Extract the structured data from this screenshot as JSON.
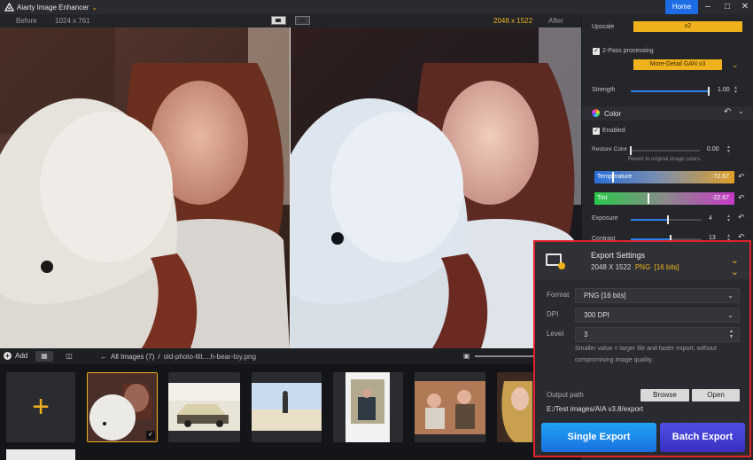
{
  "app": {
    "title": "Aiarty Image Enhancer",
    "home_label": "Home"
  },
  "compare": {
    "before_label": "Before",
    "input_size": "1024 x 761",
    "output_size": "2048 x 1522",
    "after_label": "After"
  },
  "strip": {
    "add_label": "Add",
    "breadcrumb_all": "All Images (7)",
    "breadcrumb_sep": "/",
    "breadcrumb_file": "old-photo-litt....h-bear-toy.png"
  },
  "panel": {
    "upscale_label": "Upscale",
    "upscale_value": "x2",
    "twopass_label": "2-Pass processing",
    "model_value": "More-Detail GAN  v3",
    "strength_label": "Strength",
    "strength_value": "1.00",
    "strength_level": 0.98,
    "color_header": "Color",
    "enabled_label": "Enabled",
    "restore_label": "Restore Color",
    "restore_value": "0.00",
    "restore_level": 0.0,
    "revert_text": "Revert to original image colors.",
    "temperature_label": "Temperature",
    "temperature_value": "-72.67",
    "tint_label": "Tint",
    "tint_value": "-22.67",
    "exposure_label": "Exposure",
    "exposure_value": "4",
    "exposure_level": 0.52,
    "contrast_label": "Contrast",
    "contrast_value": "13",
    "contrast_level": 0.56
  },
  "export": {
    "title": "Export Settings",
    "size": "2048 X 1522",
    "format_tag": "PNG",
    "bits_tag": "[16 bits]",
    "format_label": "Format",
    "format_value": "PNG   [16 bits]",
    "dpi_label": "DPI",
    "dpi_value": "300 DPI",
    "level_label": "Level",
    "level_value": "3",
    "note": "Smaller value = larger file and faster export, without compromising image quality.",
    "output_label": "Output path",
    "browse_label": "Browse",
    "open_label": "Open",
    "path_value": "E:/Test images/AIA v3.8/export",
    "single_label": "Single Export",
    "batch_label": "Batch Export"
  },
  "colors": {
    "accent": "#f0b21c",
    "primary": "#1d6ce6",
    "highlight_border": "#e0222a"
  },
  "icons": [
    "app-logo-icon",
    "chevron-down-icon",
    "minimize-icon",
    "maximize-icon",
    "close-icon",
    "add-icon",
    "grid-view-icon",
    "list-view-icon",
    "back-arrow-icon",
    "image-icon",
    "undo-icon",
    "palette-icon",
    "monitor-settings-icon",
    "double-chevron-down-icon",
    "check-icon",
    "plus-icon"
  ]
}
